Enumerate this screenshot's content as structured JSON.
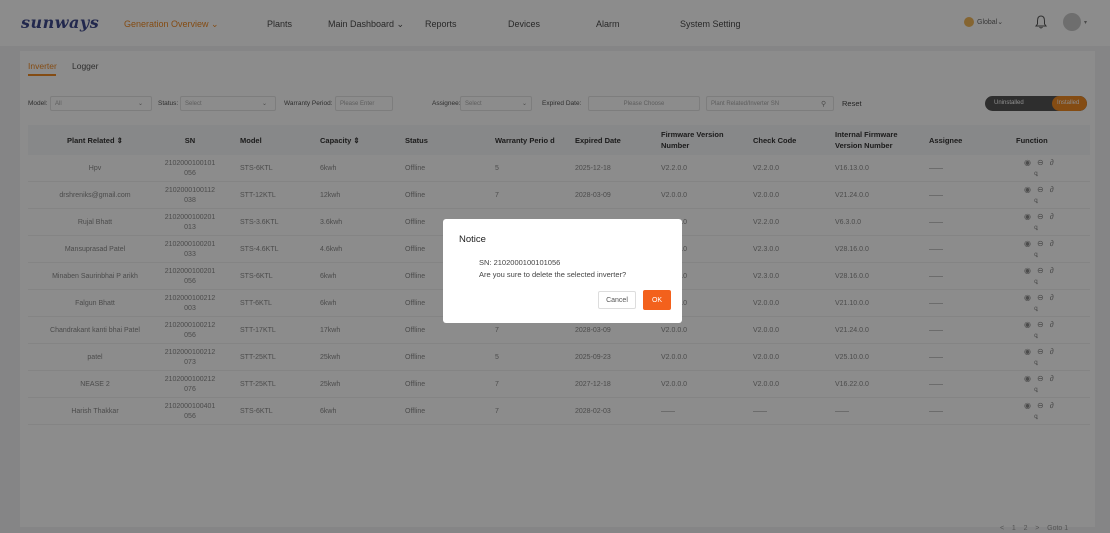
{
  "nav": {
    "logo": "sunways",
    "items": [
      {
        "label": "Generation Overview ⌄",
        "active": true
      },
      {
        "label": "Plants"
      },
      {
        "label": "Main Dashboard ⌄"
      },
      {
        "label": "Reports"
      },
      {
        "label": "Devices"
      },
      {
        "label": "Alarm"
      },
      {
        "label": "System Setting"
      }
    ],
    "global": "Global⌄"
  },
  "tabs": [
    {
      "label": "Inverter",
      "active": true
    },
    {
      "label": "Logger"
    }
  ],
  "filters": {
    "model_label": "Model:",
    "model_value": "All",
    "status_label": "Status:",
    "status_placeholder": "Select",
    "warranty_label": "Warranty Period:",
    "warranty_placeholder": "Please Enter",
    "assignee_label": "Assignee:",
    "assignee_placeholder": "Select",
    "expired_label": "Expired Date:",
    "expired_placeholder": "Please Choose",
    "search_placeholder": "Plant Related/Inverter SN",
    "reset": "Reset",
    "toggle_left": "Uninstalled",
    "toggle_right": "Installed"
  },
  "table": {
    "headers": [
      "Plant Related ⇕",
      "SN",
      "Model",
      "Capacity ⇕",
      "Status",
      "Warranty Perio d",
      "Expired Date",
      "Firmware Version Number",
      "Check Code",
      "Internal Firmware Version Number",
      "Assignee",
      "Function"
    ],
    "rows": [
      [
        "Hpv",
        "2102000100101 056",
        "STS-6KTL",
        "6kwh",
        "Offline",
        "5",
        "2025-12-18",
        "V2.2.0.0",
        "V2.2.0.0",
        "V16.13.0.0",
        "——"
      ],
      [
        "drshreniks@gmail.com",
        "2102000100112 038",
        "STT-12KTL",
        "12kwh",
        "Offline",
        "7",
        "2028-03-09",
        "V2.0.0.0",
        "V2.0.0.0",
        "V21.24.0.0",
        "——"
      ],
      [
        "Rujal Bhatt",
        "2102000100201 013",
        "STS-3.6KTL",
        "3.6kwh",
        "Offline",
        "",
        "",
        "V2.0.0.0",
        "V2.2.0.0",
        "V6.3.0.0",
        "——"
      ],
      [
        "Mansuprasad Patel",
        "2102000100201 033",
        "STS-4.6KTL",
        "4.6kwh",
        "Offline",
        "",
        "",
        "V2.3.0.0",
        "V2.3.0.0",
        "V28.16.0.0",
        "——"
      ],
      [
        "Minaben Saurinbhai P arikh",
        "2102000100201 056",
        "STS-6KTL",
        "6kwh",
        "Offline",
        "",
        "",
        "V2.3.0.0",
        "V2.3.0.0",
        "V28.16.0.0",
        "——"
      ],
      [
        "Falgun Bhatt",
        "2102000100212 003",
        "STT-6KTL",
        "6kwh",
        "Offline",
        "",
        "",
        "V2.0.0.0",
        "V2.0.0.0",
        "V21.10.0.0",
        "——"
      ],
      [
        "Chandrakant kanti bhai Patel",
        "2102000100212 056",
        "STT-17KTL",
        "17kwh",
        "Offline",
        "7",
        "2028-03-09",
        "V2.0.0.0",
        "V2.0.0.0",
        "V21.24.0.0",
        "——"
      ],
      [
        "patel",
        "2102000100212 073",
        "STT-25KTL",
        "25kwh",
        "Offline",
        "5",
        "2025-09-23",
        "V2.0.0.0",
        "V2.0.0.0",
        "V25.10.0.0",
        "——"
      ],
      [
        "NEASE 2",
        "2102000100212 076",
        "STT-25KTL",
        "25kwh",
        "Offline",
        "7",
        "2027-12-18",
        "V2.0.0.0",
        "V2.0.0.0",
        "V16.22.0.0",
        "——"
      ],
      [
        "Harish Thakkar",
        "2102000100401 056",
        "STS-6KTL",
        "6kwh",
        "Offline",
        "7",
        "2028-02-03",
        "——",
        "——",
        "——",
        "——"
      ]
    ]
  },
  "pagination": {
    "prev": "<",
    "page1": "1",
    "page2": "2",
    "next": ">",
    "goto": "Goto",
    "goto_value": "1"
  },
  "dialog": {
    "title": "Notice",
    "sn": "SN: 2102000100101056",
    "message": "Are you sure to delete the selected inverter?",
    "cancel": "Cancel",
    "ok": "OK"
  }
}
